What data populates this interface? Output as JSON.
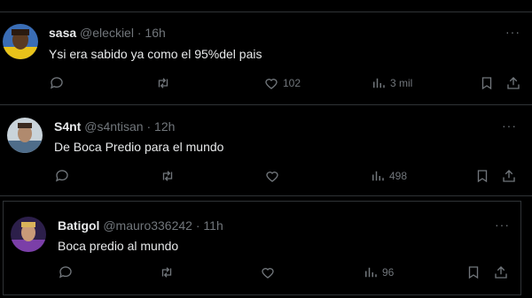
{
  "colors": {
    "background": "#000000",
    "text": "#e7e9ea",
    "muted": "#71767b",
    "border": "#2f3336"
  },
  "tweets": [
    {
      "name": "sasa",
      "handle": "@eleckiel",
      "sep": "·",
      "time": "16h",
      "text": "Ysi era sabido ya como el 95%del pais",
      "likes": "102",
      "views": "3 mil",
      "more": "···"
    },
    {
      "name": "S4nt",
      "handle": "@s4ntisan",
      "sep": "·",
      "time": "12h",
      "text": "De Boca Predio para el mundo",
      "likes": "",
      "views": "498",
      "more": "···"
    },
    {
      "name": "Batigol",
      "handle": "@mauro336242",
      "sep": "·",
      "time": "11h",
      "text": "Boca predio al mundo",
      "likes": "",
      "views": "96",
      "more": "···"
    }
  ],
  "icons": [
    "reply-icon",
    "retweet-icon",
    "like-icon",
    "views-icon",
    "bookmark-icon",
    "share-icon",
    "more-icon"
  ]
}
